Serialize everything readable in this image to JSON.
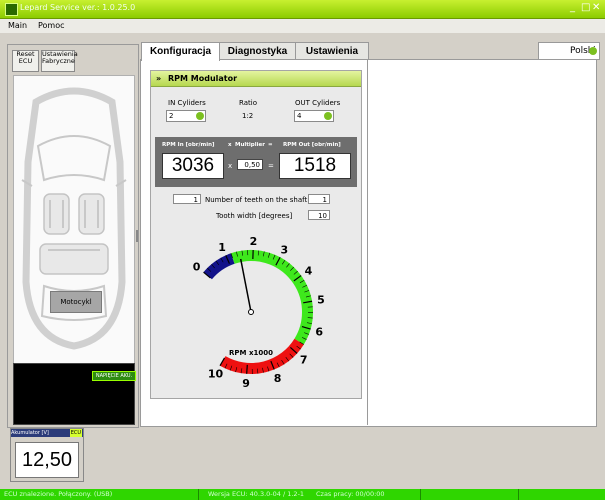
{
  "window": {
    "title": "Lepard Service  ver.: 1.0.25.0"
  },
  "menu": [
    "Main",
    "Pomoc"
  ],
  "left": {
    "reset_label": "Reset\nECU",
    "factory_label": "Ustawienia\nFabryczne",
    "car_label": "Motocykl",
    "battery_badge": "NAPIĘCIE AKU."
  },
  "battery_widget": {
    "header": "Akumulator [V]",
    "badge": "ECU",
    "value": "12,50"
  },
  "tabs": [
    "Konfiguracja",
    "Diagnostyka",
    "Ustawienia"
  ],
  "language": "Polski",
  "rpm": {
    "title": "RPM Modulator",
    "in_label": "IN Cyliders",
    "ratio_label": "Ratio",
    "ratio_value": "1:2",
    "out_label": "OUT Cyliders",
    "in_value": "2",
    "out_value": "4",
    "header_in": "RPM In [obr/min]",
    "header_x": "x",
    "header_mult": "Multiplier",
    "header_eq": "=",
    "header_out": "RPM Out [obr/min]",
    "rpm_in": "3036",
    "mult_x": "x",
    "multiplier": "0,50",
    "eq": "=",
    "rpm_out": "1518",
    "teeth_value": "1",
    "teeth_label": "Number of teeth on the shaft",
    "teeth_value2": "1",
    "width_label": "Tooth width [degrees]",
    "width_value": "10"
  },
  "gauge": {
    "label": "RPM x1000",
    "ticks": [
      "0",
      "1",
      "2",
      "3",
      "4",
      "5",
      "6",
      "7",
      "8",
      "9",
      "10"
    ],
    "value": 1.5,
    "max": 10,
    "colors": {
      "low": "#13138a",
      "mid": "#3ee81c",
      "high": "#ee1111"
    }
  },
  "statusbar": {
    "connection": "ECU znalezione. Połączony. (USB)",
    "version": "Wersja ECU: 40.3.0-04 / 1.2-1",
    "uptime": "Czas pracy: 00/00:00"
  }
}
